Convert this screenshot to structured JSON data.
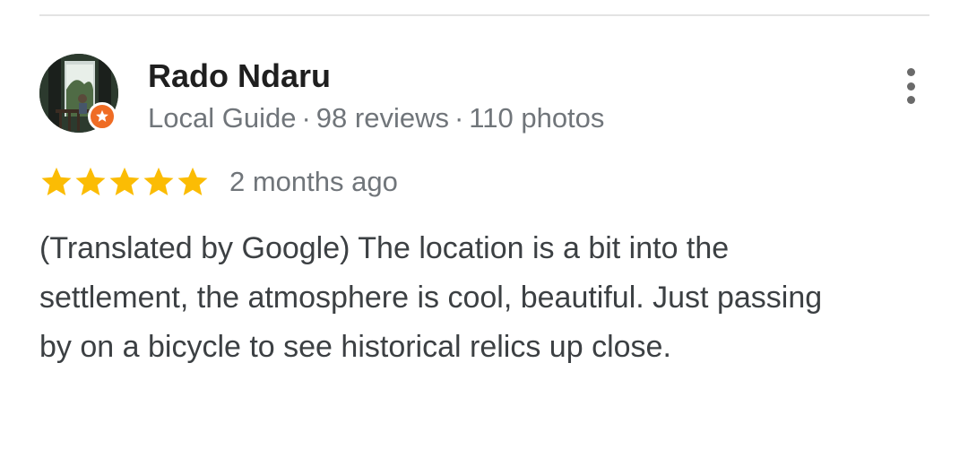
{
  "reviewer": {
    "name": "Rado Ndaru",
    "level": "Local Guide",
    "separator": "·",
    "reviews": "98 reviews",
    "photos": "110 photos"
  },
  "review": {
    "rating_stars": 5,
    "date": "2 months ago",
    "text": "(Translated by Google) The location is a bit into the settlement, the atmosphere is cool, beautiful. Just passing by on a bicycle to see historical relics up close."
  },
  "icons": {
    "avatar": "avatar-photo",
    "badge": "local-guide-star-icon",
    "more": "more-vert-icon",
    "star": "star-icon"
  },
  "colors": {
    "star": "#fbbc04",
    "badge": "#ef6c24",
    "secondary_text": "#70757a"
  }
}
